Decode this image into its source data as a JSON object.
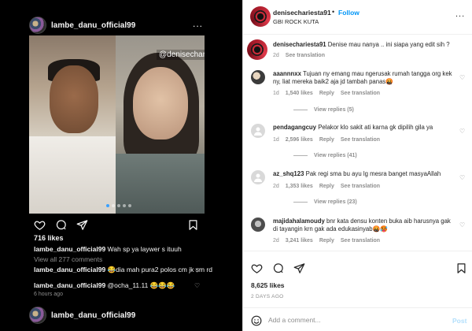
{
  "feed": {
    "username": "lambe_danu_official99",
    "more": "...",
    "watermark": "@denisecharie",
    "likes": "716 likes",
    "caption_user": "lambe_danu_official99",
    "caption_text": "Wah sp ya laywer s ituuh",
    "view_all": "View all 277 comments",
    "comments": [
      {
        "user": "lambe_danu_official99",
        "text": "😂dia mah pura2 polos cm jk sm rd"
      },
      {
        "user": "lambe_danu_official99",
        "text": "@ocha_11.11 😂😂😂"
      }
    ],
    "time": "6 hours ago",
    "next_username": "lambe_danu_official99"
  },
  "post": {
    "username": "denisechariesta91",
    "dot": "•",
    "follow": "Follow",
    "location": "GBI ROCK KUTA",
    "more": "...",
    "caption": {
      "user": "denisechariesta91",
      "text": "Denise mau nanya .. ini siapa yang edit sih ?",
      "time": "2d",
      "translate": "See translation"
    },
    "comments": [
      {
        "user": "aaannnxx",
        "text": "Tujuan ny emang mau ngerusak rumah tangga org kek ny, liat mereka baik2 aja jd tambah panas🤬",
        "time": "1d",
        "likes": "1,540 likes",
        "reply": "Reply",
        "translate": "See translation",
        "view_replies": "View replies (5)"
      },
      {
        "user": "pendagangcuy",
        "text": "Pelakor klo sakit ati karna gk dipilih gila ya",
        "time": "1d",
        "likes": "2,596 likes",
        "reply": "Reply",
        "translate": "See translation",
        "view_replies": "View replies (41)"
      },
      {
        "user": "az_shq123",
        "text": "Pak regi sma bu ayu lg mesra banget masyaAllah",
        "time": "2d",
        "likes": "1,353 likes",
        "reply": "Reply",
        "translate": "See translation",
        "view_replies": "View replies (23)"
      },
      {
        "user": "majidahalamoudy",
        "text": "bnr kata densu konten buka aib harusnya gak di tayangin krn gak ada edukasinyab🤬🥵",
        "time": "2d",
        "likes": "3,241 likes",
        "reply": "Reply",
        "translate": "See translation"
      }
    ],
    "likes": "8,625 likes",
    "date": "2 DAYS AGO",
    "add_placeholder": "Add a comment...",
    "post_label": "Post"
  },
  "colors": {
    "accent": "#0095f6",
    "post_disabled": "#b2dffc",
    "muted": "#8e8e8e"
  }
}
